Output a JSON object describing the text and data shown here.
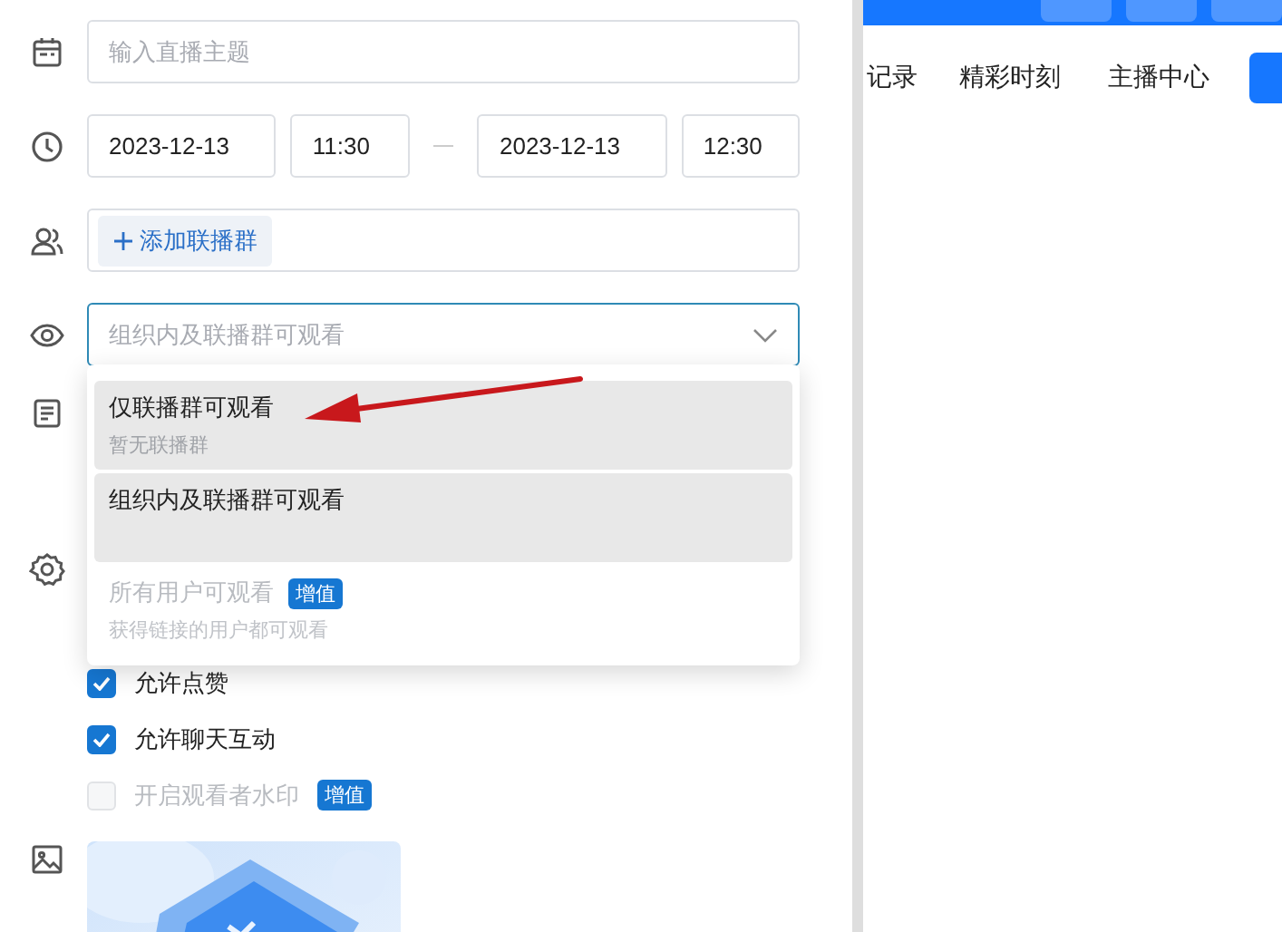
{
  "form": {
    "title_field": {
      "placeholder": "输入直播主题"
    },
    "time": {
      "start_date": "2023-12-13",
      "start_time": "11:30",
      "end_date": "2023-12-13",
      "end_time": "12:30"
    },
    "co_stream": {
      "add_button": "添加联播群"
    },
    "visibility": {
      "placeholder": "组织内及联播群可观看",
      "expanded": true,
      "options": [
        {
          "label": "仅联播群可观看",
          "hint": "暂无联播群",
          "highlighted": true,
          "disabled": false
        },
        {
          "label": "组织内及联播群可观看",
          "highlighted": true,
          "disabled": false
        },
        {
          "label": "所有用户可观看",
          "badge": "增值",
          "hint": "获得链接的用户都可观看",
          "highlighted": false,
          "disabled": true
        }
      ]
    },
    "checkboxes": [
      {
        "label": "允许点赞",
        "checked": true,
        "disabled": false
      },
      {
        "label": "允许聊天互动",
        "checked": true,
        "disabled": false
      },
      {
        "label": "开启观看者水印",
        "badge": "增值",
        "checked": false,
        "disabled": true
      }
    ]
  },
  "nav": {
    "tabs": [
      {
        "label": "记录"
      },
      {
        "label": "精彩时刻"
      },
      {
        "label": "主播中心"
      }
    ]
  }
}
